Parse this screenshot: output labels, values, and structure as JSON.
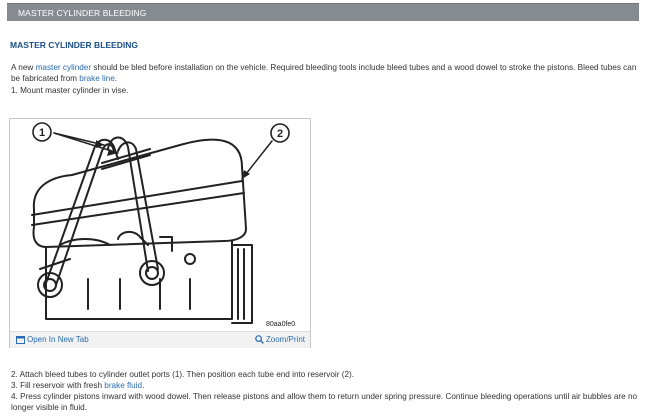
{
  "header": {
    "title": "MASTER CYLINDER BLEEDING"
  },
  "section": {
    "title": "MASTER CYLINDER BLEEDING"
  },
  "intro": {
    "part1": "A new ",
    "link1": "master cylinder",
    "part2": " should be bled before installation on the vehicle. Required bleeding tools include bleed tubes and a wood dowel to stroke the pistons. Bleed tubes can be fabricated from ",
    "link2": "brake line",
    "part3": "."
  },
  "step1": "1. Mount master cylinder in vise.",
  "figure": {
    "callout1": "1",
    "callout2": "2",
    "code": "80aa0fe0",
    "open_label": "Open In New Tab",
    "zoom_label": "Zoom/Print",
    "open_icon": "external-window-icon",
    "zoom_icon": "magnifier-icon"
  },
  "steps": {
    "s2": "2. Attach bleed tubes to cylinder outlet ports (1). Then position each tube end into reservoir (2).",
    "s3_part1": "3. Fill reservoir with fresh ",
    "s3_link": "brake fluid",
    "s3_part2": ".",
    "s4": "4. Press cylinder pistons inward with wood dowel. Then release pistons and allow them to return under spring pressure. Continue bleeding operations until air bubbles are no longer visible in fluid."
  },
  "colors": {
    "header_bg": "#858b90",
    "title": "#1a4f8a",
    "link": "#2a6bb5"
  }
}
